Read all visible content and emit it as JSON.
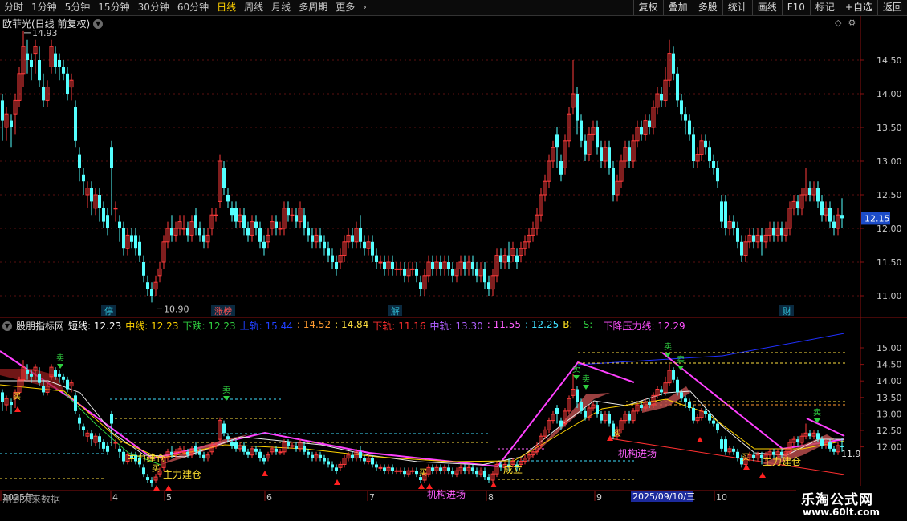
{
  "toolbar": {
    "tabs": [
      {
        "label": "分时",
        "active": false
      },
      {
        "label": "1分钟",
        "active": false
      },
      {
        "label": "5分钟",
        "active": false
      },
      {
        "label": "15分钟",
        "active": false
      },
      {
        "label": "30分钟",
        "active": false
      },
      {
        "label": "60分钟",
        "active": false
      },
      {
        "label": "日线",
        "active": true
      },
      {
        "label": "周线",
        "active": false
      },
      {
        "label": "月线",
        "active": false
      },
      {
        "label": "多周期",
        "active": false
      },
      {
        "label": "更多",
        "active": false
      }
    ],
    "more_icon": "chevron-right-icon",
    "right_buttons": [
      "复权",
      "叠加",
      "多股",
      "统计",
      "画线",
      "F10",
      "标记",
      "+自选",
      "返回"
    ]
  },
  "kline": {
    "title": "欧菲光(日线 前复权)",
    "dropdown_icon": "chevron-down-icon",
    "diamond_icon": "diamond-icon",
    "gear_icon": "gear-icon",
    "max_label": "14.93",
    "min_label": "10.90",
    "current_price": "12.15",
    "yticks": [
      "14.50",
      "14.00",
      "13.50",
      "13.00",
      "12.50",
      "12.00",
      "11.50",
      "11.00"
    ],
    "tags": [
      {
        "text": "停",
        "color": "#2fb8d0"
      },
      {
        "text": "涨榜",
        "color": "#ff5050"
      },
      {
        "text": "解",
        "color": "#2fb8d0"
      },
      {
        "text": "财",
        "color": "#2fb8d0"
      }
    ]
  },
  "indicator": {
    "name": "股朋指标网",
    "items": [
      {
        "label": "短线:",
        "value": "12.23",
        "color": "#ffffff"
      },
      {
        "label": "中线:",
        "value": "12.23",
        "color": "#ffd400"
      },
      {
        "label": "下跌:",
        "value": "12.23",
        "color": "#30d040"
      },
      {
        "label": "上轨:",
        "value": "15.44",
        "color": "#2040ff"
      },
      {
        "label": ":",
        "value": "14.52",
        "color": "#ff9a30"
      },
      {
        "label": ":",
        "value": "14.84",
        "color": "#ffe040"
      },
      {
        "label": "下轨:",
        "value": "11.16",
        "color": "#ff3030"
      },
      {
        "label": "中轨:",
        "value": "13.30",
        "color": "#b060ff"
      },
      {
        "label": ":",
        "value": "11.55",
        "color": "#ff60ff"
      },
      {
        "label": ":",
        "value": "12.25",
        "color": "#40e0ff"
      },
      {
        "label": "B:",
        "value": "-",
        "color": "#ffe020"
      },
      {
        "label": "S:",
        "value": "-",
        "color": "#30d040"
      },
      {
        "label": "下降压力线:",
        "value": "12.29",
        "color": "#ff50ff"
      }
    ],
    "yticks": [
      "15.00",
      "14.50",
      "14.00",
      "13.50",
      "13.00",
      "12.50",
      "12.00"
    ],
    "last_value": "11.9",
    "annotations": [
      {
        "text": "主力建仓",
        "color": "#ffe030"
      },
      {
        "text": "主力建仓",
        "color": "#ffe030"
      },
      {
        "text": "机构进场",
        "color": "#ff60ff"
      },
      {
        "text": "成立",
        "color": "#ffe030"
      },
      {
        "text": "机构进场",
        "color": "#ff60ff"
      },
      {
        "text": "主力建仓",
        "color": "#ffe030"
      }
    ],
    "sell_mark": "卖",
    "buy_mark": "买"
  },
  "future_text": "用到未来数据",
  "xaxis": {
    "labels": [
      "2025年",
      "4",
      "5",
      "6",
      "7",
      "8",
      "9",
      "10"
    ],
    "highlight": "2025/09/10/三"
  },
  "logo": {
    "title": "乐淘公式网",
    "url": "www.60lt.com"
  },
  "colors": {
    "up": "#ff3b3b",
    "down": "#54ffff"
  }
}
